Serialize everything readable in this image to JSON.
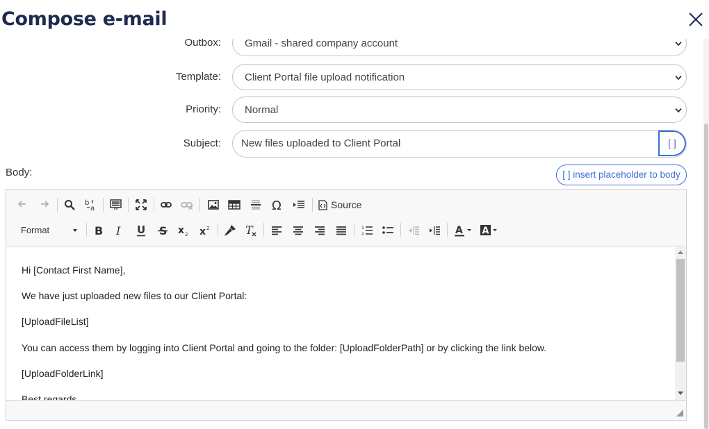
{
  "dialog": {
    "title": "Compose e-mail",
    "close_icon": "close-icon"
  },
  "form": {
    "outbox": {
      "label": "Outbox:",
      "value": "Gmail - shared company account"
    },
    "template": {
      "label": "Template:",
      "value": "Client Portal file upload notification"
    },
    "priority": {
      "label": "Priority:",
      "value": "Normal"
    },
    "subject": {
      "label": "Subject:",
      "value": "New files uploaded to Client Portal",
      "placeholder_button": "[ ]"
    },
    "body_label": "Body:",
    "insert_placeholder_button": "[ ] insert placeholder to body"
  },
  "toolbar": {
    "source_label": "Source",
    "format_label": "Format",
    "icons": [
      "undo-icon",
      "redo-icon",
      "find-icon",
      "replace-icon",
      "select-all-icon",
      "maximize-icon",
      "link-icon",
      "unlink-icon",
      "image-icon",
      "table-icon",
      "horizontal-line-icon",
      "special-char-icon",
      "indent-block-icon",
      "source-icon",
      "bold-icon",
      "italic-icon",
      "underline-icon",
      "strikethrough-icon",
      "subscript-icon",
      "superscript-icon",
      "copy-format-icon",
      "remove-format-icon",
      "align-left-icon",
      "align-center-icon",
      "align-right-icon",
      "justify-icon",
      "numbered-list-icon",
      "bulleted-list-icon",
      "outdent-icon",
      "indent-icon",
      "text-color-icon",
      "background-color-icon"
    ]
  },
  "editor": {
    "lines": [
      "Hi [Contact First Name],",
      "We have just uploaded new files to our Client Portal:",
      "[UploadFileList]",
      "You can access them by logging into Client Portal and going to the folder: [UploadFolderPath] or by clicking the link below.",
      "[UploadFolderLink]",
      "Best regards,"
    ]
  },
  "colors": {
    "title": "#1d2b4f",
    "accent": "#3a6fd8",
    "border": "#bfc5cc"
  }
}
